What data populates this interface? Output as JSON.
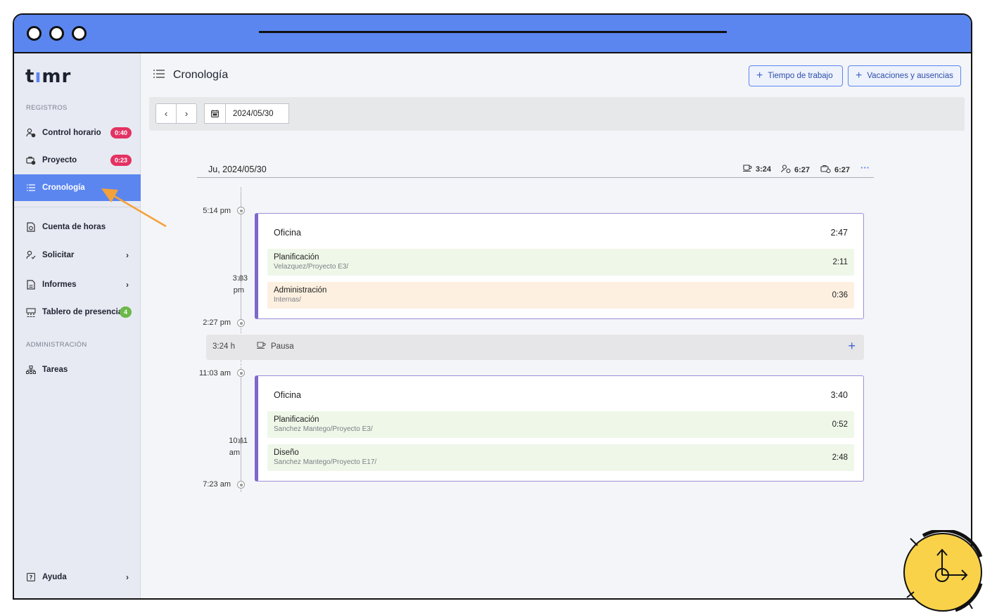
{
  "sidebar": {
    "logo": "timr",
    "section_records": "REGISTROS",
    "section_admin": "ADMINISTRACIÓN",
    "items": [
      {
        "label": "Control horario",
        "badge": "0:40"
      },
      {
        "label": "Proyecto",
        "badge": "0:23"
      },
      {
        "label": "Cronología"
      },
      {
        "label": "Cuenta de horas"
      },
      {
        "label": "Solicitar"
      },
      {
        "label": "Informes"
      },
      {
        "label": "Tablero de presencia",
        "badge": "4"
      },
      {
        "label": "Tareas"
      },
      {
        "label": "Ayuda"
      }
    ]
  },
  "header": {
    "title": "Cronología",
    "btn_work_time": "Tiempo de trabajo",
    "btn_vacations": "Vacaciones y ausencias"
  },
  "toolbar": {
    "date": "2024/05/30"
  },
  "day": {
    "label": "Ju, 2024/05/30",
    "break_total": "3:24",
    "work_total": "6:27",
    "project_total": "6:27",
    "more": "···"
  },
  "timeline": {
    "t1": "5:14 pm",
    "t2a": "3:03",
    "t2b": "pm",
    "t3": "2:27 pm",
    "t4": "11:03 am",
    "t5a": "10:11",
    "t5b": "am",
    "t6": "7:23 am"
  },
  "card1": {
    "title": "Oficina",
    "duration": "2:47",
    "entries": [
      {
        "title": "Planificación",
        "sub": "Velazquez/Proyecto E3/",
        "duration": "2:11"
      },
      {
        "title": "Administración",
        "sub": "Internas/",
        "duration": "0:36"
      }
    ]
  },
  "pause": {
    "duration": "3:24 h",
    "label": "Pausa",
    "add": "+"
  },
  "card2": {
    "title": "Oficina",
    "duration": "3:40",
    "entries": [
      {
        "title": "Planificación",
        "sub": "Sanchez Mantego/Proyecto E3/",
        "duration": "0:52"
      },
      {
        "title": "Diseño",
        "sub": "Sanchez Mantego/Proyecto E17/",
        "duration": "2:48"
      }
    ]
  }
}
